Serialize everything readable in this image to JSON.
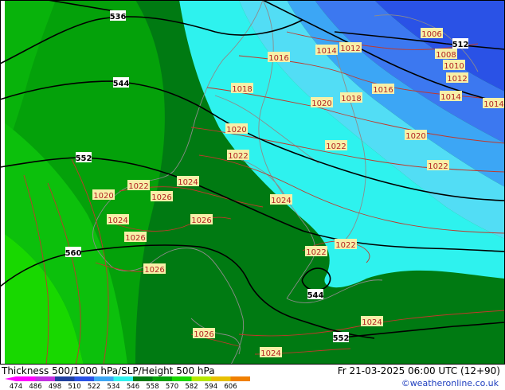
{
  "title": "Thickness 500/1000 hPa/SLP/Height 500 hPa",
  "valid_time": "Fr 21-03-2025 06:00 UTC (12+90)",
  "credit": "©weatheronline.co.uk",
  "colors": {
    "slp_contour": "#c0392b",
    "height_contour": "#000000",
    "coast": "#8c8c8c",
    "thickness_blue_dark": "#2a52e6",
    "thickness_blue": "#3c78f0",
    "thickness_lightblue": "#3ca6f5",
    "thickness_cyan": "#52ddf5",
    "thickness_aqua": "#2ef2ee",
    "thickness_green_dark": "#007a12",
    "thickness_green": "#04a10a",
    "thickness_green_light": "#0cc00c",
    "thickness_lime": "#18d800"
  },
  "legend": {
    "ticks": [
      "474",
      "486",
      "498",
      "510",
      "522",
      "534",
      "546",
      "558",
      "570",
      "582",
      "594",
      "606"
    ],
    "colors": [
      "#ff00ff",
      "#c030e0",
      "#2040a0",
      "#2a52e6",
      "#3ca6f5",
      "#2ef2ee",
      "#007a12",
      "#04a10a",
      "#18d800",
      "#b8e800",
      "#e8c000",
      "#f08000"
    ]
  },
  "height_labels": [
    {
      "text": "536"
    },
    {
      "text": "544"
    },
    {
      "text": "552"
    },
    {
      "text": "560"
    },
    {
      "text": "512"
    },
    {
      "text": "544"
    },
    {
      "text": "552"
    }
  ],
  "slp_labels": [
    {
      "text": "1006"
    },
    {
      "text": "1008"
    },
    {
      "text": "1010"
    },
    {
      "text": "1012"
    },
    {
      "text": "1014"
    },
    {
      "text": "1012"
    },
    {
      "text": "1014"
    },
    {
      "text": "1016"
    },
    {
      "text": "1018"
    },
    {
      "text": "1018"
    },
    {
      "text": "1016"
    },
    {
      "text": "1020"
    },
    {
      "text": "1020"
    },
    {
      "text": "1020"
    },
    {
      "text": "1022"
    },
    {
      "text": "1022"
    },
    {
      "text": "1022"
    },
    {
      "text": "1024"
    },
    {
      "text": "1022"
    },
    {
      "text": "1020"
    },
    {
      "text": "1026"
    },
    {
      "text": "1024"
    },
    {
      "text": "1026"
    },
    {
      "text": "1024"
    },
    {
      "text": "1026"
    },
    {
      "text": "1026"
    },
    {
      "text": "1022"
    },
    {
      "text": "1022"
    },
    {
      "text": "1024"
    },
    {
      "text": "1026"
    },
    {
      "text": "1024"
    },
    {
      "text": "1014"
    }
  ]
}
